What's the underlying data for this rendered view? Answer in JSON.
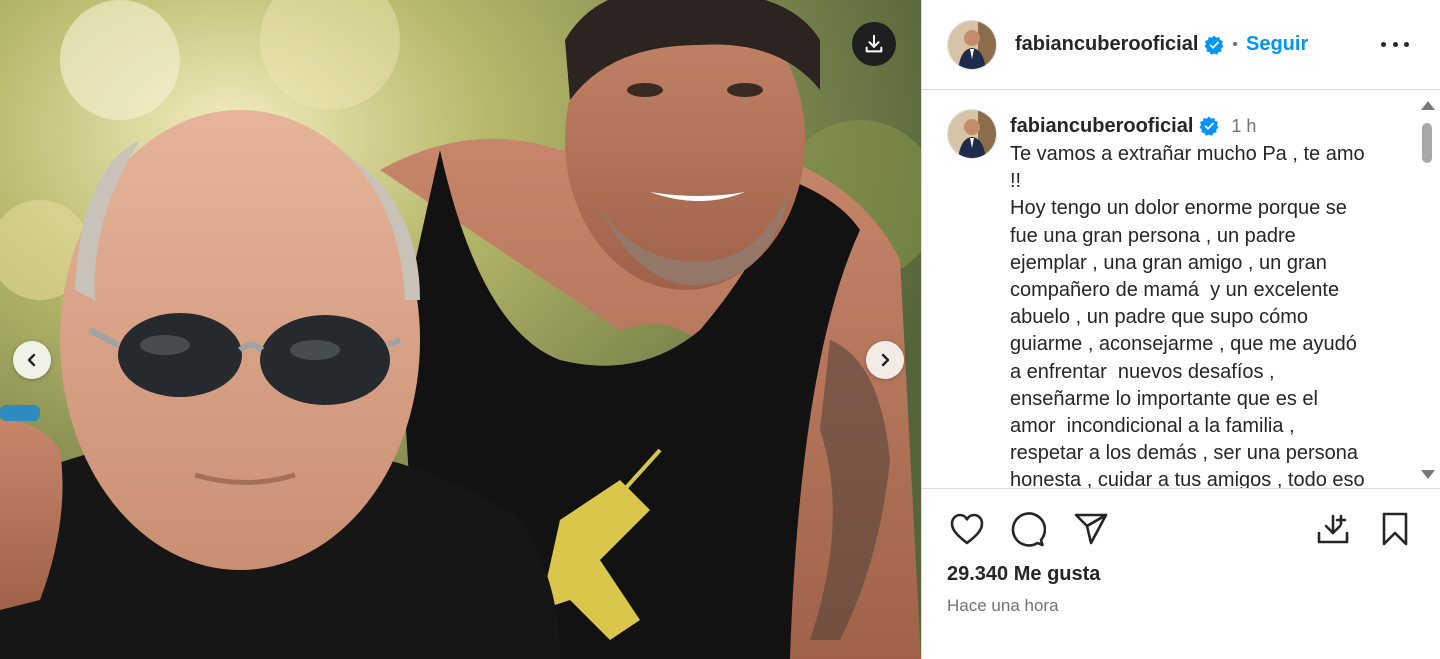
{
  "post": {
    "username": "fabiancuberooficial",
    "follow_label": "Seguir",
    "separator": "•"
  },
  "caption": {
    "username": "fabiancuberooficial",
    "time": "1 h",
    "text": "Te vamos a extrañar mucho Pa , te amo\n!!\nHoy tengo un dolor enorme porque se\nfue una gran persona , un padre\nejemplar , una gran amigo , un gran\ncompañero de mamá  y un excelente\nabuelo , un padre que supo cómo\nguiarme , aconsejarme , que me ayudó\na enfrentar  nuevos desafíos ,\nenseñarme lo importante que es el\namor  incondicional a la familia ,\nrespetar a los demás , ser una persona\nhonesta , cuidar a tus amigos , todo eso"
  },
  "stats": {
    "likes": "29.340 Me gusta",
    "posted": "Hace una hora"
  },
  "icons": {
    "download": "download-icon",
    "prev": "chevron-left-icon",
    "next": "chevron-right-icon",
    "verified": "verified-badge-icon",
    "more": "more-options-icon",
    "like": "heart-icon",
    "comment": "comment-icon",
    "share": "send-icon",
    "save_download": "download-tray-icon",
    "bookmark": "bookmark-icon"
  },
  "colors": {
    "link": "#0095f6",
    "verified": "#0095f6",
    "text": "#262626",
    "muted": "#737373"
  }
}
